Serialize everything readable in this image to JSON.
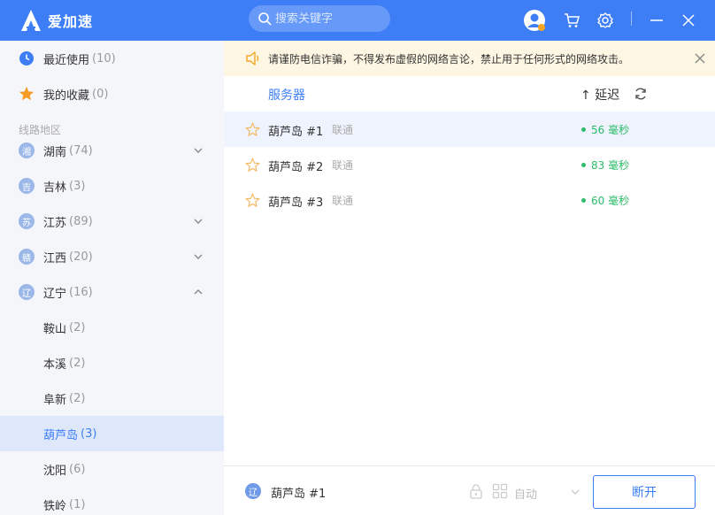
{
  "app": {
    "name": "爱加速"
  },
  "search": {
    "placeholder": "搜索关键字"
  },
  "sidebar": {
    "recent": {
      "label": "最近使用",
      "count": "(10)"
    },
    "favorites": {
      "label": "我的收藏",
      "count": "(0)"
    },
    "section_title": "线路地区",
    "regions": [
      {
        "badge": "湘",
        "label": "湖南",
        "count": "(74)"
      },
      {
        "badge": "吉",
        "label": "吉林",
        "count": "(3)"
      },
      {
        "badge": "苏",
        "label": "江苏",
        "count": "(89)"
      },
      {
        "badge": "赣",
        "label": "江西",
        "count": "(20)"
      },
      {
        "badge": "辽",
        "label": "辽宁",
        "count": "(16)"
      }
    ],
    "cities": [
      {
        "label": "鞍山",
        "count": "(2)"
      },
      {
        "label": "本溪",
        "count": "(2)"
      },
      {
        "label": "阜新",
        "count": "(2)"
      },
      {
        "label": "葫芦岛",
        "count": "(3)"
      },
      {
        "label": "沈阳",
        "count": "(6)"
      },
      {
        "label": "铁岭",
        "count": "(1)"
      }
    ]
  },
  "notice": {
    "text": "请谨防电信诈骗，不得发布虚假的网络言论，禁止用于任何形式的网络攻击。"
  },
  "list": {
    "col_server": "服务器",
    "col_latency": "↑ 延迟",
    "rows": [
      {
        "name": "葫芦岛 #1",
        "isp": "联通",
        "latency": "56 毫秒"
      },
      {
        "name": "葫芦岛 #2",
        "isp": "联通",
        "latency": "83 毫秒"
      },
      {
        "name": "葫芦岛 #3",
        "isp": "联通",
        "latency": "60 毫秒"
      }
    ]
  },
  "footer": {
    "badge": "辽",
    "current_server": "葫芦岛 #1",
    "mode": "自动",
    "disconnect_label": "断开"
  },
  "colors": {
    "primary": "#3d7ef7",
    "latency_green": "#2dbb6b",
    "notice_bg": "#fdf6e3"
  }
}
